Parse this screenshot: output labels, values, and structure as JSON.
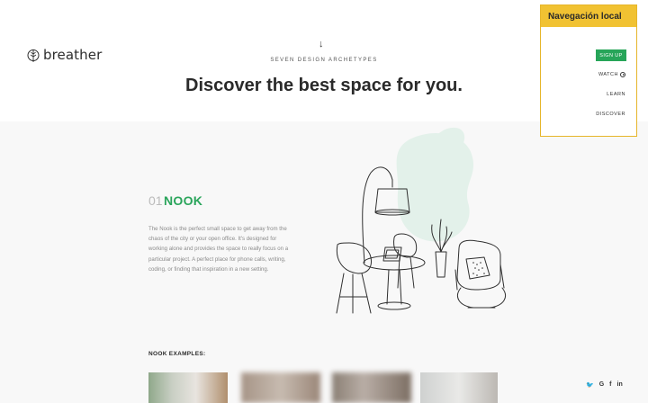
{
  "brand": {
    "logo_text": "breather"
  },
  "hero": {
    "eyebrow": "SEVEN DESIGN ARCHETYPES",
    "headline": "Discover the best space for you.",
    "arrow": "↓"
  },
  "archetype": {
    "number": "01",
    "title": "NOOK",
    "description": "The Nook is the perfect small space to get away from the chaos of the city or your open office. It's designed for working alone and provides the space to really focus on a particular project. A perfect place for phone calls, writing, coding, or finding that inspiration in a new setting."
  },
  "examples": {
    "label": "NOOK EXAMPLES:"
  },
  "social": {
    "items": [
      "twitter-icon",
      "google-icon",
      "facebook-icon",
      "linkedin-icon"
    ],
    "glyphs": [
      "🐦",
      "G",
      "f",
      "in"
    ]
  },
  "local_nav": {
    "header": "Navegación local",
    "signup": "SIGN UP",
    "watch": "WATCH",
    "learn": "LEARN",
    "discover": "DISCOVER"
  },
  "colors": {
    "accent_green": "#27a559",
    "highlight_yellow": "#f1c232",
    "blob_mint": "#e3f1ea"
  }
}
